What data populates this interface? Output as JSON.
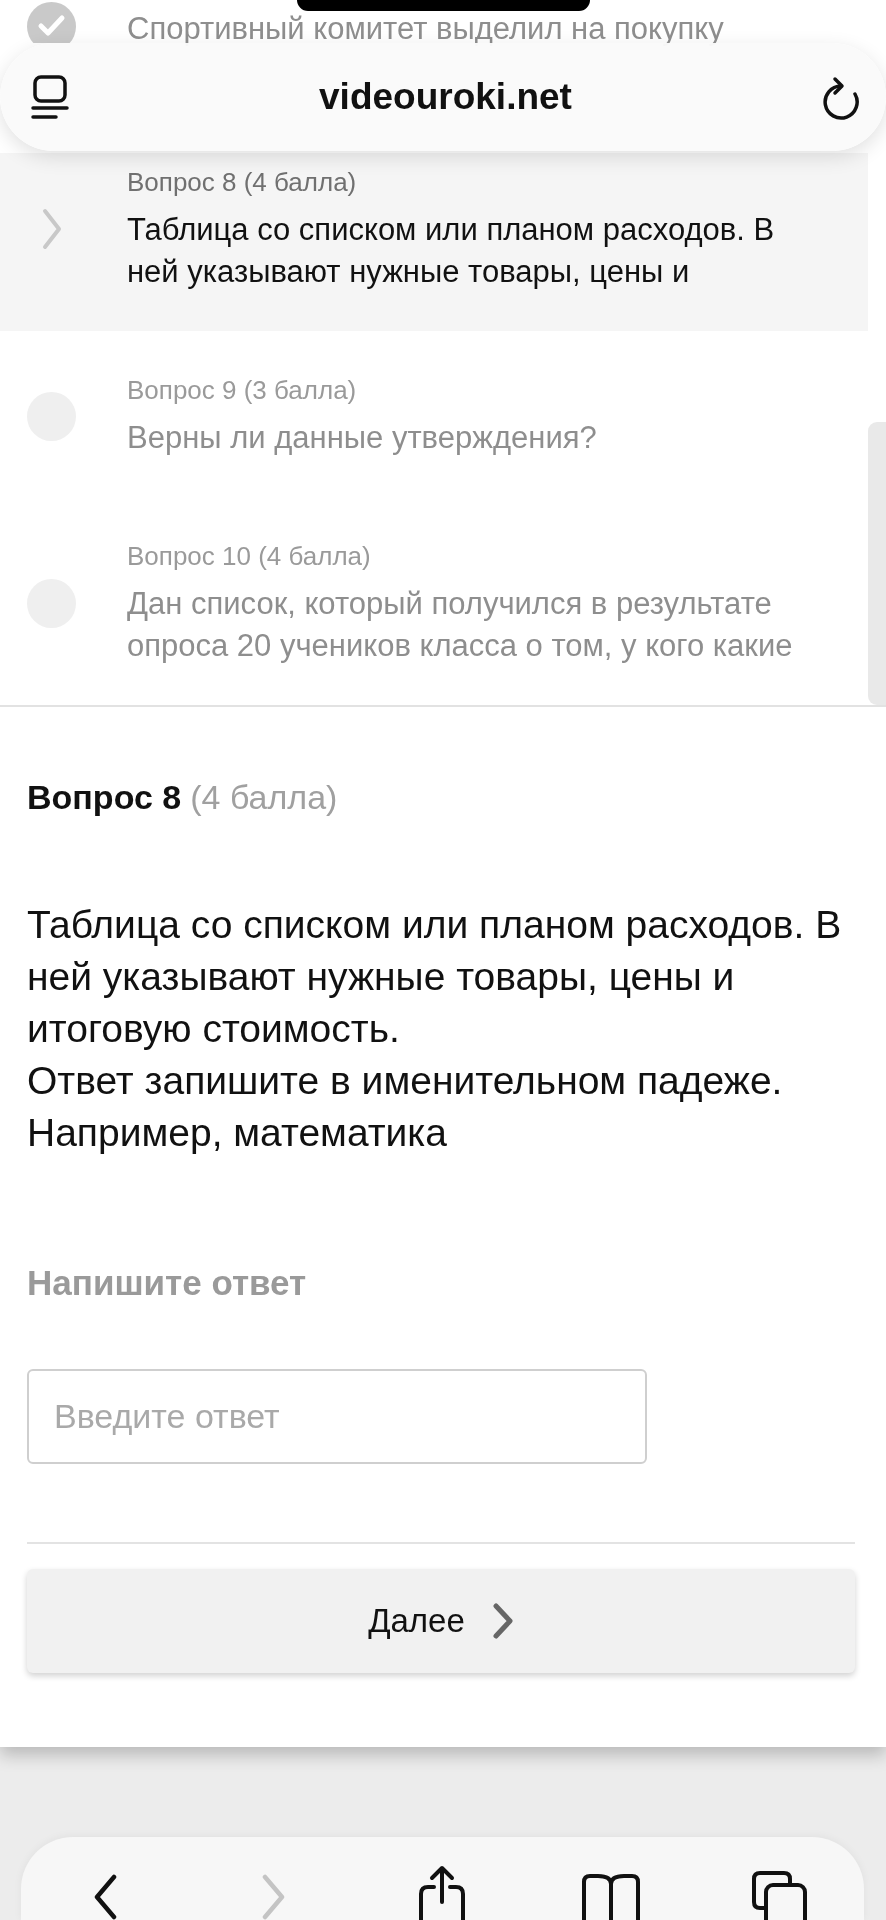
{
  "browser": {
    "url": "videouroki.net"
  },
  "question_list": {
    "items": [
      {
        "kind": "answered",
        "selected": false,
        "text": "Спортивный комитет выделил на покупку"
      },
      {
        "kind": "current",
        "selected": true,
        "label": "Вопрос 8 (4 балла)",
        "text": "Таблица со списком или планом расходов. В ней указывают нужные товары, цены и"
      },
      {
        "kind": "unanswered",
        "selected": false,
        "label": "Вопрос 9 (3 балла)",
        "text": "Верны ли данные утверждения?"
      },
      {
        "kind": "unanswered",
        "selected": false,
        "label": "Вопрос 10 (4 балла)",
        "text": "Дан список, который получился в результате опроса 20 учеников класса о том, у кого какие"
      }
    ]
  },
  "question": {
    "title": "Вопрос 8",
    "points": "(4 балла)",
    "text": [
      "Таблица со списком или планом расходов. В ней указывают нужные товары, цены и итоговую стоимость.",
      "Ответ запишите в именительном падеже.",
      "Например, математика"
    ]
  },
  "answer": {
    "label": "Напишите ответ",
    "placeholder": "Введите ответ"
  },
  "next_button": {
    "label": "Далее"
  },
  "toolbar": {
    "buttons": [
      {
        "kind": "back",
        "disabled": false
      },
      {
        "kind": "forward",
        "disabled": true
      },
      {
        "kind": "share",
        "disabled": false
      },
      {
        "kind": "bookmarks",
        "disabled": false
      },
      {
        "kind": "tabs",
        "disabled": false
      }
    ]
  }
}
